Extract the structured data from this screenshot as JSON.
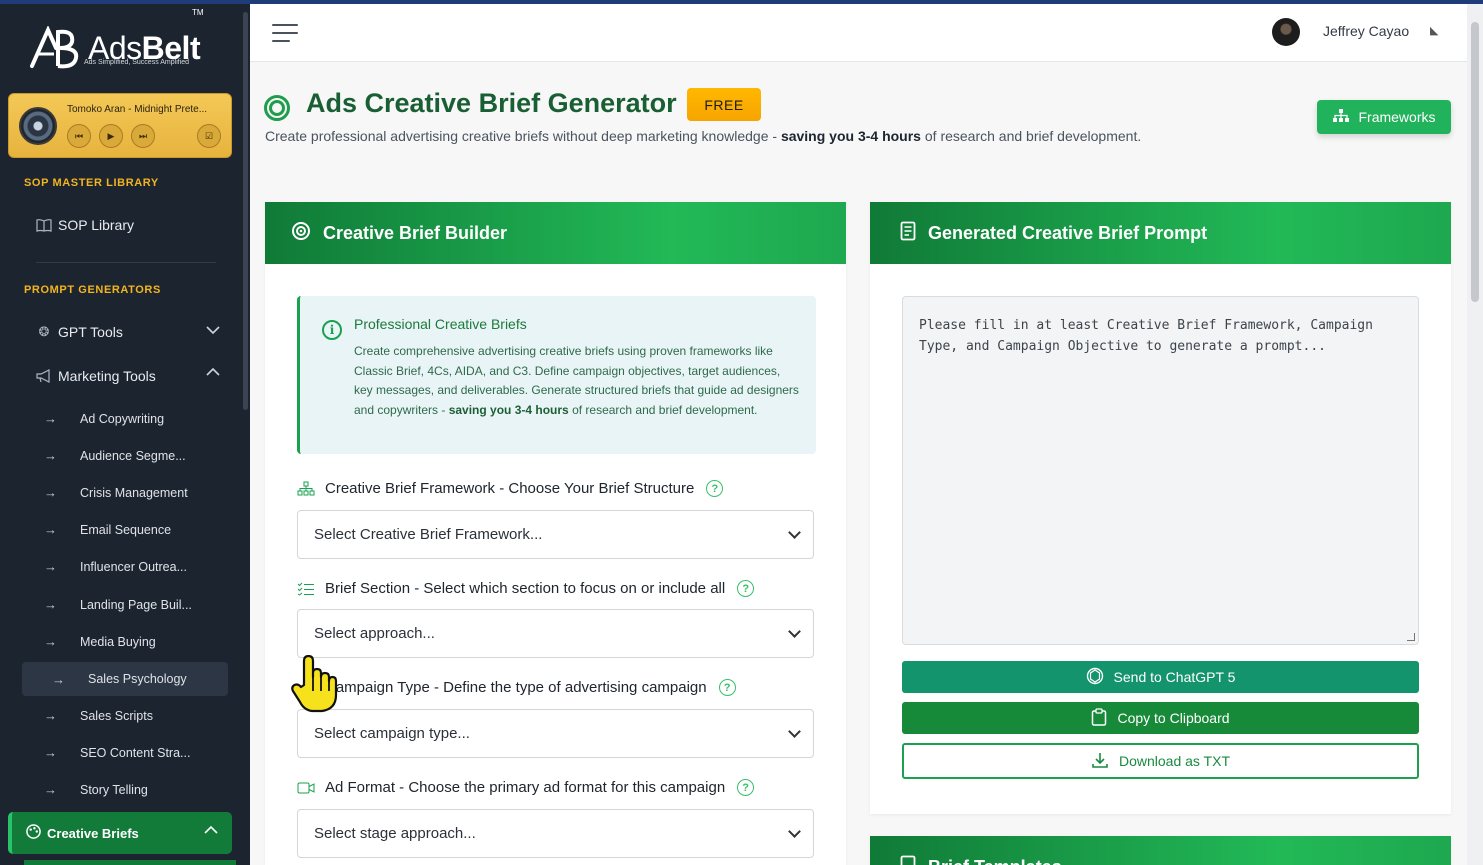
{
  "sidebar": {
    "logo_text": "AdsBelt",
    "logo_tagline": "Ads Simplified, Success Amplified",
    "player": {
      "title": "Tomoko Aran - Midnight Prete..."
    },
    "section_sop": "SOP MASTER LIBRARY",
    "sop_library": "SOP Library",
    "section_prompts": "PROMPT GENERATORS",
    "gpt_tools": "GPT Tools",
    "marketing_tools": "Marketing Tools",
    "sub_items": [
      "Ad Copywriting",
      "Audience Segme...",
      "Crisis Management",
      "Email Sequence",
      "Influencer Outrea...",
      "Landing Page Buil...",
      "Media Buying",
      "Sales Psychology",
      "Sales Scripts",
      "SEO Content Stra...",
      "Story Telling"
    ],
    "active_group": "Creative Briefs"
  },
  "header": {
    "username": "Jeffrey Cayao"
  },
  "page": {
    "title": "Ads Creative Brief Generator",
    "badge": "FREE",
    "subtitle_pre": "Create professional advertising creative briefs without deep marketing knowledge - ",
    "subtitle_bold": "saving you 3-4 hours",
    "subtitle_post": " of research and brief development.",
    "frameworks_button": "Frameworks"
  },
  "builder": {
    "title": "Creative Brief Builder",
    "info_title": "Professional Creative Briefs",
    "info_text_pre": "Create comprehensive advertising creative briefs using proven frameworks like Classic Brief, 4Cs, AIDA, and C3. Define campaign objectives, target audiences, key messages, and deliverables. Generate structured briefs that guide ad designers and copywriters - ",
    "info_text_bold": "saving you 3-4 hours",
    "info_text_post": " of research and brief development.",
    "fields": [
      {
        "label": "Creative Brief Framework - Choose Your Brief Structure",
        "placeholder": "Select Creative Brief Framework..."
      },
      {
        "label": "Brief Section - Select which section to focus on or include all",
        "placeholder": "Select approach..."
      },
      {
        "label": "Campaign Type - Define the type of advertising campaign",
        "placeholder": "Select campaign type..."
      },
      {
        "label": "Ad Format - Choose the primary ad format for this campaign",
        "placeholder": "Select stage approach..."
      }
    ]
  },
  "output": {
    "title": "Generated Creative Brief Prompt",
    "prompt_text": "Please fill in at least Creative Brief Framework, Campaign Type, and Campaign Objective to generate a prompt...",
    "send_button": "Send to ChatGPT 5",
    "copy_button": "Copy to Clipboard",
    "download_button": "Download as TXT",
    "templates_title": "Brief Templates"
  },
  "colors": {
    "brand_green": "#1aa04f",
    "sidebar_bg": "#1c2430",
    "accent_gold": "#f2b51f",
    "free_badge": "#ffb800"
  }
}
